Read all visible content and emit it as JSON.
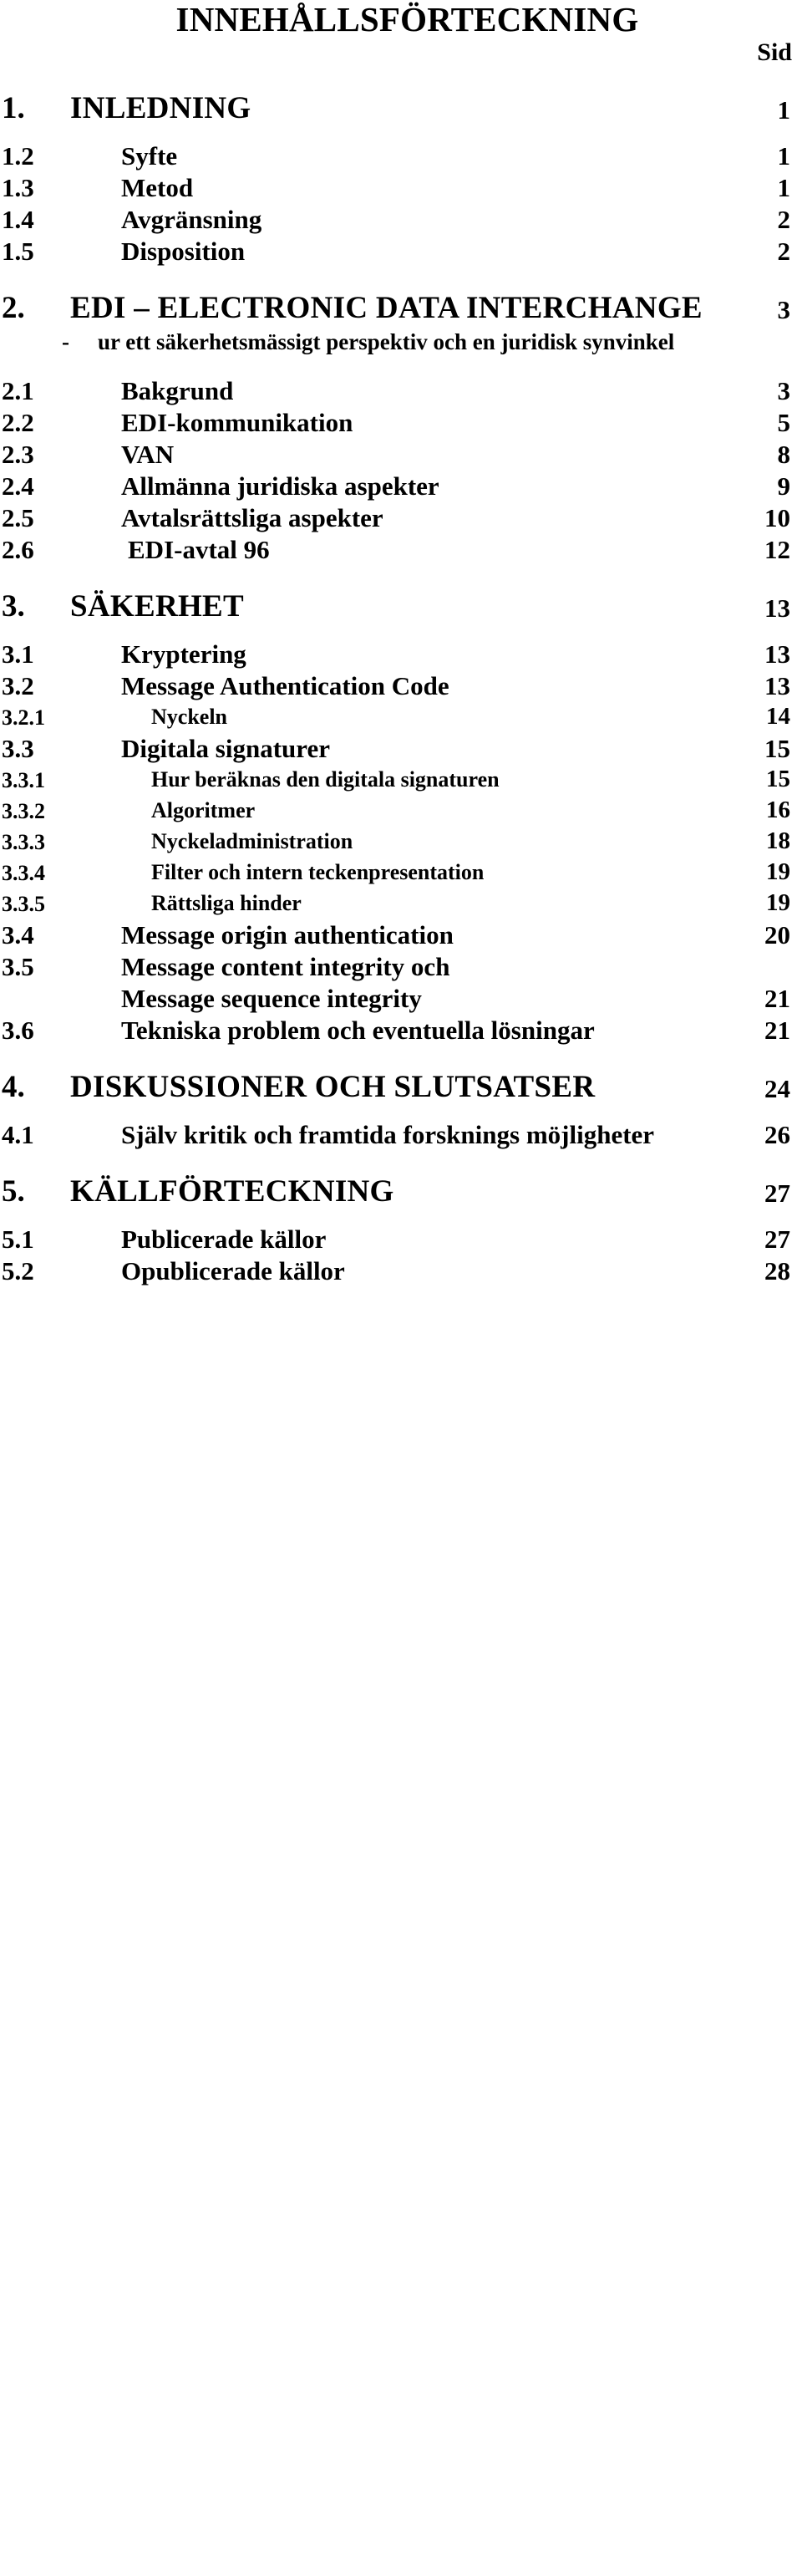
{
  "document": {
    "title": "INNEHÅLLSFÖRTECKNING",
    "page_column_label": "Sid"
  },
  "toc": {
    "entries": [
      {
        "number": "1.",
        "label": "INLEDNING",
        "page": "1",
        "level": "chapter"
      },
      {
        "number": "1.2",
        "label": "Syfte",
        "page": "1",
        "level": "section"
      },
      {
        "number": "1.3",
        "label": "Metod",
        "page": "1",
        "level": "section"
      },
      {
        "number": "1.4",
        "label": "Avgränsning",
        "page": "2",
        "level": "section"
      },
      {
        "number": "1.5",
        "label": "Disposition",
        "page": "2",
        "level": "section"
      },
      {
        "number": "2.",
        "label": "EDI – ELECTRONIC DATA INTERCHANGE",
        "page": "3",
        "level": "chapter"
      },
      {
        "number": "-",
        "label": "ur ett säkerhetsmässigt perspektiv och en juridisk synvinkel",
        "page": "",
        "level": "subtitle"
      },
      {
        "number": "2.1",
        "label": "Bakgrund",
        "page": "3",
        "level": "section"
      },
      {
        "number": "2.2",
        "label": "EDI-kommunikation",
        "page": "5",
        "level": "section"
      },
      {
        "number": "2.3",
        "label": "VAN",
        "page": "8",
        "level": "section"
      },
      {
        "number": "2.4",
        "label": "Allmänna juridiska aspekter",
        "page": "9",
        "level": "section"
      },
      {
        "number": "2.5",
        "label": "Avtalsrättsliga aspekter",
        "page": "10",
        "level": "section"
      },
      {
        "number": "2.6",
        "label": "EDI-avtal 96",
        "page": "12",
        "level": "section"
      },
      {
        "number": "3.",
        "label": "SÄKERHET",
        "page": "13",
        "level": "chapter"
      },
      {
        "number": "3.1",
        "label": "Kryptering",
        "page": "13",
        "level": "section"
      },
      {
        "number": "3.2",
        "label": "Message Authentication Code",
        "page": "13",
        "level": "section"
      },
      {
        "number": "3.2.1",
        "label": "Nyckeln",
        "page": "14",
        "level": "subsection"
      },
      {
        "number": "3.3",
        "label": "Digitala signaturer",
        "page": "15",
        "level": "section"
      },
      {
        "number": "3.3.1",
        "label": "Hur beräknas den digitala signaturen",
        "page": "15",
        "level": "subsection"
      },
      {
        "number": "3.3.2",
        "label": "Algoritmer",
        "page": "16",
        "level": "subsection"
      },
      {
        "number": "3.3.3",
        "label": "Nyckeladministration",
        "page": "18",
        "level": "subsection"
      },
      {
        "number": "3.3.4",
        "label": "Filter och intern teckenpresentation",
        "page": "19",
        "level": "subsection"
      },
      {
        "number": "3.3.5",
        "label": "Rättsliga hinder",
        "page": "19",
        "level": "subsection"
      },
      {
        "number": "3.4",
        "label": "Message origin authentication",
        "page": "20",
        "level": "section"
      },
      {
        "number": "3.5",
        "label": "Message content integrity och",
        "page": "",
        "level": "section"
      },
      {
        "number": "",
        "label": "Message sequence integrity",
        "page": "21",
        "level": "continuation"
      },
      {
        "number": "3.6",
        "label": "Tekniska problem och eventuella lösningar",
        "page": "21",
        "level": "section"
      },
      {
        "number": "4.",
        "label": "DISKUSSIONER OCH SLUTSATSER",
        "page": "24",
        "level": "chapter"
      },
      {
        "number": "4.1",
        "label": "Själv kritik och framtida forsknings möjligheter",
        "page": "26",
        "level": "section"
      },
      {
        "number": "5.",
        "label": "KÄLLFÖRTECKNING",
        "page": "27",
        "level": "chapter"
      },
      {
        "number": "5.1",
        "label": "Publicerade källor",
        "page": "27",
        "level": "section"
      },
      {
        "number": "5.2",
        "label": "Opublicerade källor",
        "page": "28",
        "level": "section"
      }
    ]
  }
}
